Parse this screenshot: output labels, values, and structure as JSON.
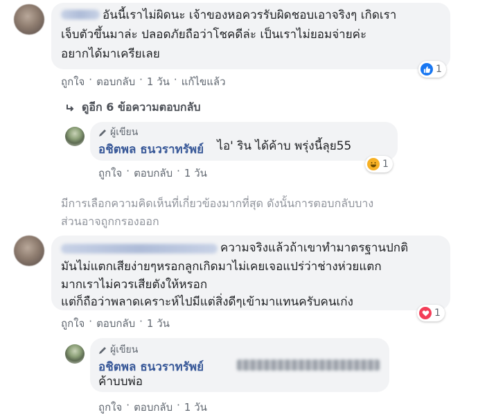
{
  "comment1": {
    "text_lines": [
      "อันนี้เราไม่ผิดนะ เจ้าของหอควรรับผิดชอบเอาจริงๆ เกิดเรา",
      "เจ็บตัวขึ้นมาล่ะ ปลอดภัยถือว่าโชคดีล่ะ เป็นเราไม่ยอมจ่ายค่ะ",
      "อยากได้มาเครียเลย"
    ],
    "actions": {
      "like": "ถูกใจ",
      "reply": "ตอบกลับ",
      "time": "1 วัน",
      "edited": "แก้ไขแล้ว"
    },
    "reaction_count": "1",
    "reaction_icon": "like-icon"
  },
  "more_replies": "ดูอีก 6 ข้อความตอบกลับ",
  "reply1": {
    "author_badge": "ผู้เขียน",
    "author_name": "อชิตพล ธนวราทรัพย์",
    "text": " ไอ' ริน ได้ค้าบ พรุ่งนี้ลุย55",
    "actions": {
      "like": "ถูกใจ",
      "reply": "ตอบกลับ",
      "time": "1 วัน"
    },
    "reaction_count": "1",
    "reaction_icon": "haha-icon"
  },
  "notice_lines": [
    "มีการเลือกความคิดเห็นที่เกี่ยวข้องมากที่สุด ดังนั้นการตอบกลับบาง",
    "ส่วนอาจถูกกรองออก"
  ],
  "comment2": {
    "text_lines": [
      "ความจริงแล้วถ้าเขาทำมาตรฐานปกติ",
      "มันไม่แตกเสียง่ายๆหรอกลูกเกิดมาไม่เคยเจอแปร่ว่าช่างห่วยแตก",
      "มากเราไม่ควรเสียตังให้หรอก",
      "แต่ก็ถือว่าพลาดเคราะห์ไปมีแต่สิ่งดีๆเข้ามาแทนครับคนเก่ง"
    ],
    "actions": {
      "like": "ถูกใจ",
      "reply": "ตอบกลับ",
      "time": "1 วัน"
    },
    "reaction_count": "1",
    "reaction_icon": "love-icon"
  },
  "reply2": {
    "author_badge": "ผู้เขียน",
    "author_name": "อชิตพล ธนวราทรัพย์",
    "text": "ค้าบบพ่อ",
    "actions": {
      "like": "ถูกใจ",
      "reply": "ตอบกลับ",
      "time": "1 วัน"
    }
  },
  "colors": {
    "link_blue": "#385898",
    "like_blue": "#1877f2",
    "haha_yellow": "#f7b125",
    "love_red": "#f33e58",
    "bubble_gray": "#f2f3f5"
  }
}
